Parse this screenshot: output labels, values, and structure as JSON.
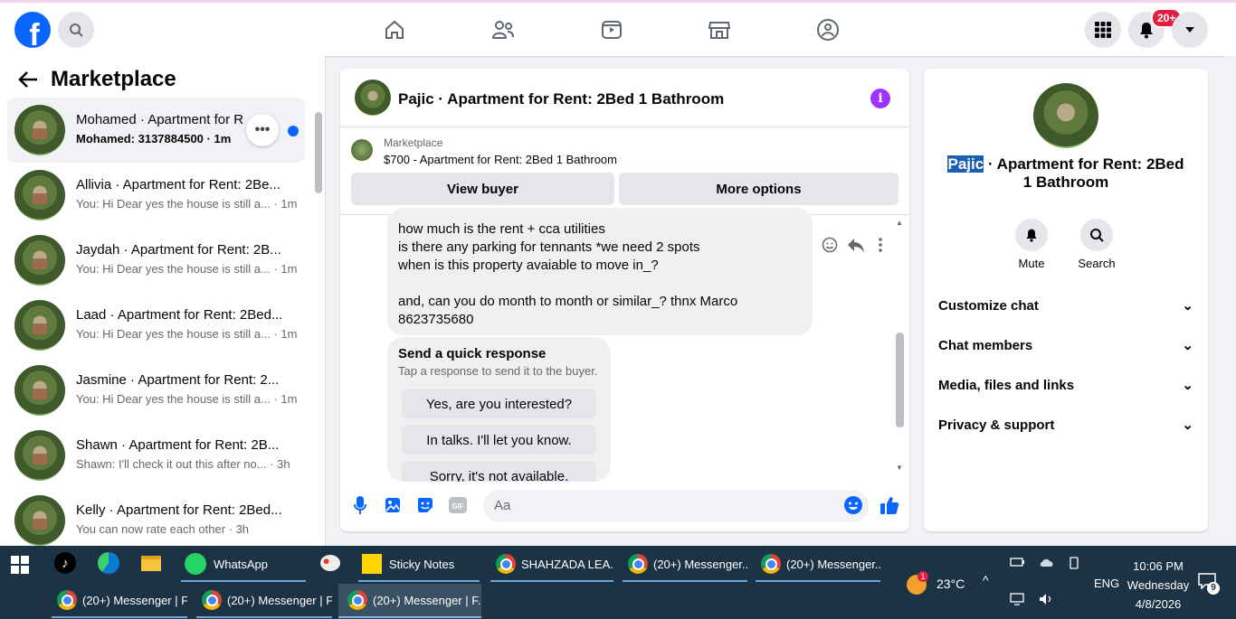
{
  "topbar": {
    "logo": "f",
    "notifications_badge": "20+",
    "nav_icons": [
      "home-icon",
      "friends-icon",
      "watch-icon",
      "marketplace-icon",
      "groups-icon"
    ]
  },
  "sidebar": {
    "title": "Marketplace",
    "conversations": [
      {
        "title": "Mohamed · Apartment for R",
        "sub": "Mohamed: 3137884500 · 1m"
      },
      {
        "title": "Allivia · Apartment for Rent: 2Be...",
        "sub": "You: Hi Dear yes the house is still a... · 1m"
      },
      {
        "title": "Jaydah · Apartment for Rent: 2B...",
        "sub": "You: Hi Dear yes the house is still a... · 1m"
      },
      {
        "title": "Laad · Apartment for Rent: 2Bed...",
        "sub": "You: Hi Dear yes the house is still a... · 1m"
      },
      {
        "title": "Jasmine · Apartment for Rent: 2...",
        "sub": "You: Hi Dear yes the house is still a... · 1m"
      },
      {
        "title": "Shawn · Apartment for Rent: 2B...",
        "sub": "Shawn: I'll check it out this after no... · 3h"
      },
      {
        "title": "Kelly · Apartment for Rent: 2Bed...",
        "sub": "You can now rate each other · 3h"
      }
    ]
  },
  "chat": {
    "title": "Pajic · Apartment for Rent: 2Bed 1 Bathroom",
    "marketplace_label": "Marketplace",
    "listing": "$700 - Apartment for Rent: 2Bed 1 Bathroom",
    "view_buyer": "View buyer",
    "more_options": "More options",
    "message_lines": [
      "how much is the rent + cca utilities",
      "is there any parking for tennants *we need 2 spots",
      "when is this property avaiable to move in_?",
      "",
      "and, can you do month to month or similar_? thnx Marco",
      "8623735680"
    ],
    "quick_title": "Send a quick response",
    "quick_sub": "Tap a response to send it to the buyer.",
    "quick_responses": [
      "Yes, are you interested?",
      "In talks. I'll let you know.",
      "Sorry, it's not available."
    ],
    "input_placeholder": "Aa"
  },
  "info_panel": {
    "name_selected": "Pajic",
    "title_rest": " · Apartment for Rent: 2Bed 1 Bathroom",
    "mute": "Mute",
    "search": "Search",
    "rows": [
      "Customize chat",
      "Chat members",
      "Media, files and links",
      "Privacy & support"
    ]
  },
  "taskbar": {
    "row1": [
      "WhatsApp",
      "Sticky Notes",
      "SHAHZADA LEA...",
      "(20+) Messenger...",
      "(20+) Messenger..."
    ],
    "row2": [
      "(20+) Messenger | F...",
      "(20+) Messenger | F...",
      "(20+) Messenger | F..."
    ],
    "temperature": "23°C",
    "weather_badge": "1",
    "language": "ENG",
    "time": "10:06 PM",
    "day": "Wednesday",
    "date": "4/8/2026",
    "notification_count": "9"
  },
  "colors": {
    "fb_blue": "#0866ff",
    "badge_red": "#e41e3f",
    "taskbar": "#1c3345"
  }
}
